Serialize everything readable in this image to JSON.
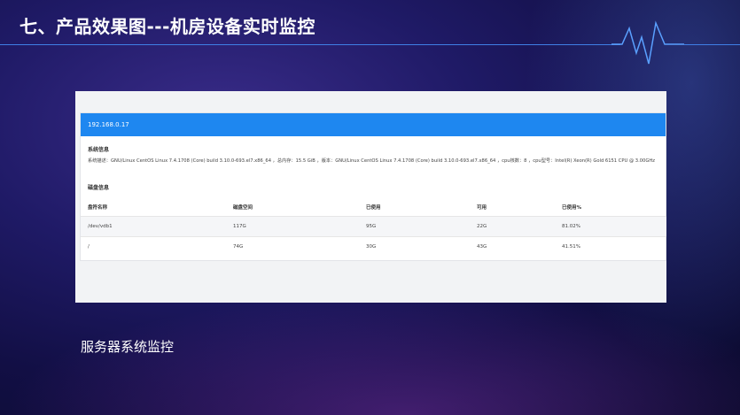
{
  "slide": {
    "title": "七、产品效果图---机房设备实时监控",
    "caption": "服务器系统监控",
    "accent_color": "#3f7fe6"
  },
  "screen": {
    "host_ip": "192.168.0.17",
    "system_info_title": "系统信息",
    "system_info_text": "系统描述：GNU/Linux CentOS Linux 7.4.1708 (Core) build 3.10.0-693.el7.x86_64 ，总内存：15.5 GiB ，版本：GNU/Linux CentOS Linux 7.4.1708 (Core) build 3.10.0-693.el7.x86_64 ，cpu核数：8 ，cpu型号：Intel(R) Xeon(R) Gold 6151 CPU @ 3.00GHz",
    "disk_info_title": "磁盘信息",
    "disk_columns": [
      "盘符名称",
      "磁盘空间",
      "已使用",
      "可用",
      "已使用%"
    ],
    "disk_rows": [
      [
        "/dev/vdb1",
        "117G",
        "95G",
        "22G",
        "81.02%"
      ],
      [
        "/",
        "74G",
        "30G",
        "43G",
        "41.51%"
      ]
    ],
    "header_color": "#1e87f0"
  }
}
